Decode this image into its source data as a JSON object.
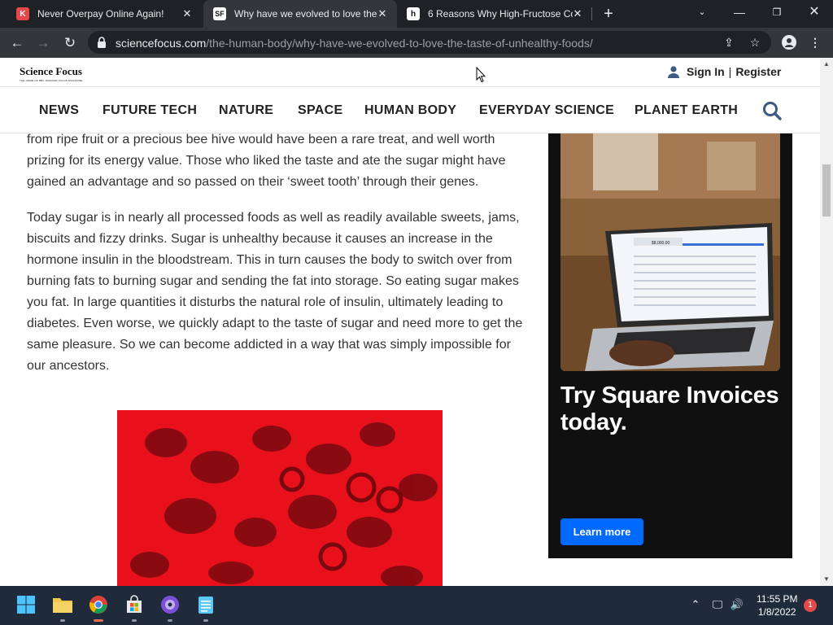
{
  "browser": {
    "tabs": [
      {
        "title": "Never Overpay Online Again!",
        "favicon": "K",
        "favicon_color": "#e5474b",
        "active": false
      },
      {
        "title": "Why have we evolved to love the",
        "favicon": "SF",
        "favicon_color": "#ffffff",
        "active": true
      },
      {
        "title": "6 Reasons Why High-Fructose Co",
        "favicon": "h",
        "favicon_color": "#111111",
        "active": false
      }
    ],
    "url_host": "sciencefocus.com",
    "url_path": "/the-human-body/why-have-we-evolved-to-love-the-taste-of-unhealthy-foods/"
  },
  "site": {
    "logo": "Science Focus",
    "logo_tagline": "THE HOME OF BBC SCIENCE FOCUS MAGAZINE",
    "sign_in": "Sign In",
    "separator": "|",
    "register": "Register",
    "nav": [
      "NEWS",
      "FUTURE TECH",
      "NATURE",
      "SPACE",
      "HUMAN BODY",
      "EVERYDAY SCIENCE",
      "PLANET EARTH"
    ]
  },
  "article": {
    "p1": "from ripe fruit or a precious bee hive would have been a rare treat, and well worth prizing for its energy value. Those who liked the taste and ate the sugar might have gained an advantage and so passed on their ‘sweet tooth’ through their genes.",
    "p2": "Today sugar is in nearly all processed foods as well as readily available sweets, jams, biscuits and fizzy drinks. Sugar is unhealthy because it causes an increase in the hormone insulin in the bloodstream. This in turn causes the body to switch over from burning fats to burning sugar and sending the fat into storage. So eating sugar makes you fat. In large quantities it disturbs the natural role of insulin, ultimately leading to diabetes. Even worse, we quickly adapt to the taste of sugar and need more to get the same pleasure. So we can become addicted in a way that was simply impossible for our ancestors."
  },
  "ad": {
    "headline": "Try Square Invoices today.",
    "button": "Learn more",
    "laptop_amount": "$8,000.00"
  },
  "taskbar": {
    "time": "11:55 PM",
    "date": "1/8/2022",
    "notifications": "1"
  },
  "colors": {
    "brand_blue": "#006aff",
    "image_red": "#e8101a",
    "search_icon": "#3d5a80"
  }
}
